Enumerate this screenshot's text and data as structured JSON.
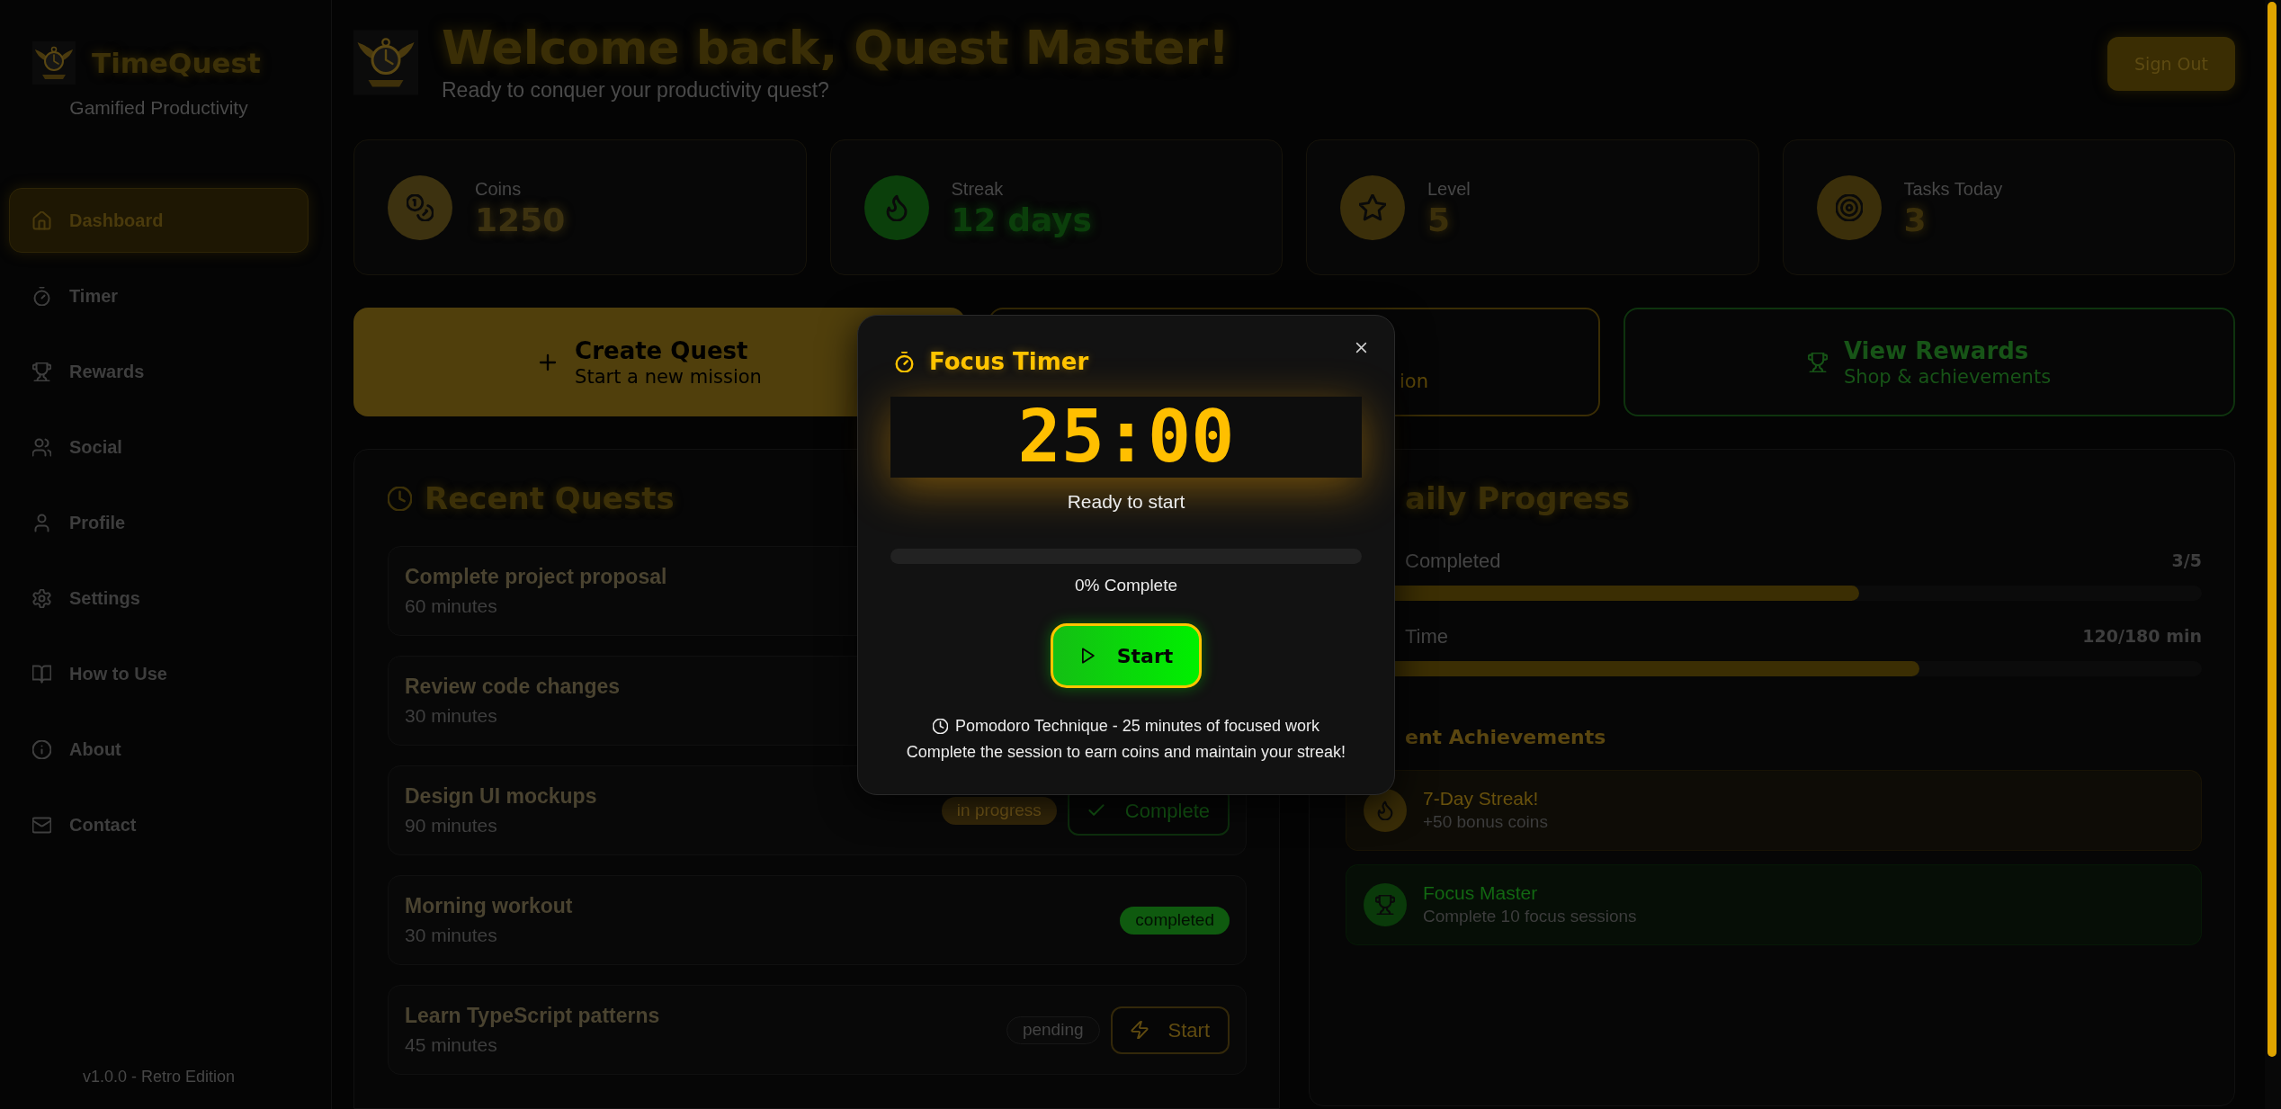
{
  "sidebar": {
    "app_name": "TimeQuest",
    "tagline": "Gamified Productivity",
    "nav": [
      {
        "label": "Dashboard",
        "selected": true
      },
      {
        "label": "Timer",
        "selected": false
      },
      {
        "label": "Rewards",
        "selected": false
      },
      {
        "label": "Social",
        "selected": false
      },
      {
        "label": "Profile",
        "selected": false
      },
      {
        "label": "Settings",
        "selected": false
      },
      {
        "label": "How to Use",
        "selected": false
      },
      {
        "label": "About",
        "selected": false
      },
      {
        "label": "Contact",
        "selected": false
      }
    ],
    "version": "v1.0.0 - Retro Edition"
  },
  "header": {
    "title": "Welcome back, Quest Master!",
    "subtitle": "Ready to conquer your productivity quest?",
    "sign_out": "Sign Out"
  },
  "stats": [
    {
      "label": "Coins",
      "value": "1250",
      "color": "#3d3210"
    },
    {
      "label": "Streak",
      "value": "12 days",
      "color": "#0b3f0b"
    },
    {
      "label": "Level",
      "value": "5",
      "color": "#3b2f0a"
    },
    {
      "label": "Tasks Today",
      "value": "3",
      "color": "#3b2f0a"
    }
  ],
  "actions": [
    {
      "kind": "filled",
      "color": "#503f0c",
      "title": "Create Quest",
      "subtitle": "Start a new mission"
    },
    {
      "kind": "outline",
      "color": "#3a2d05",
      "subtitle": "ion"
    },
    {
      "kind": "outline",
      "color": "#0e330e",
      "title": "View Rewards",
      "subtitle": "Shop & achievements"
    }
  ],
  "recent_quests": {
    "title": "Recent Quests",
    "quests": [
      {
        "title": "Complete project proposal",
        "duration": "60 minutes"
      },
      {
        "title": "Review code changes",
        "duration": "30 minutes"
      },
      {
        "title": "Design UI mockups",
        "duration": "90 minutes",
        "status": {
          "text": "in progress",
          "kind": "in_progress"
        },
        "action": {
          "label": "Complete",
          "kind": "complete"
        }
      },
      {
        "title": "Morning workout",
        "duration": "30 minutes",
        "status": {
          "text": "completed",
          "kind": "completed"
        }
      },
      {
        "title": "Learn TypeScript patterns",
        "duration": "45 minutes",
        "status": {
          "text": "pending",
          "kind": "pending"
        },
        "action": {
          "label": "Start",
          "kind": "start"
        }
      }
    ]
  },
  "daily_progress": {
    "title": "aily Progress",
    "metrics": [
      {
        "label": "Completed",
        "value": "3/5",
        "level": 0.6
      },
      {
        "label": "Time",
        "value": "120/180 min",
        "level": 0.67
      }
    ],
    "achievements_title": "ent Achievements",
    "achievements": [
      {
        "title": "7-Day Streak!",
        "detail": "+50 bonus coins",
        "color": "#3a2d07"
      },
      {
        "title": "Focus Master",
        "detail": "Complete 10 focus sessions",
        "color": "#0a3a0a"
      }
    ]
  },
  "focus_timer": {
    "title": "Focus Timer",
    "time": "25:00",
    "status": "Ready to start",
    "progress_text": "0% Complete",
    "start_button": "Start",
    "note": "Pomodoro Technique - 25 minutes of focused work",
    "footer": "Complete the session to earn coins and maintain your streak!"
  }
}
